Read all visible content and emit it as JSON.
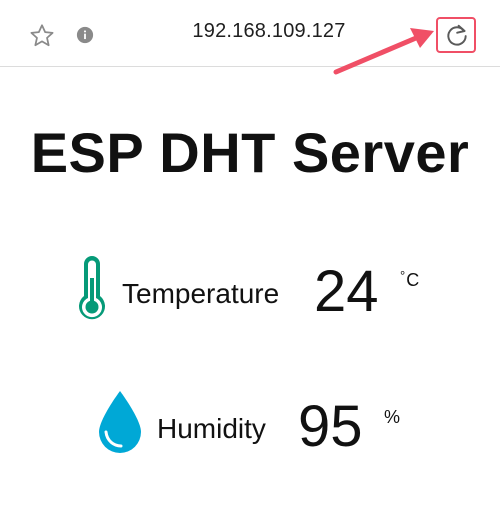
{
  "browser": {
    "url": "192.168.109.127",
    "star_icon": "star-outline-icon",
    "info_icon": "info-icon",
    "reload_icon": "reload-icon",
    "highlight_color": "#f04f66"
  },
  "page": {
    "title": "ESP DHT Server"
  },
  "readings": [
    {
      "label": "Temperature",
      "value": "24",
      "unit": "C",
      "unit_symbol": "°",
      "icon": "thermometer-icon",
      "icon_color": "#069a78"
    },
    {
      "label": "Humidity",
      "value": "95",
      "unit": "%",
      "icon": "water-drop-icon",
      "icon_color": "#00a8d6"
    }
  ]
}
